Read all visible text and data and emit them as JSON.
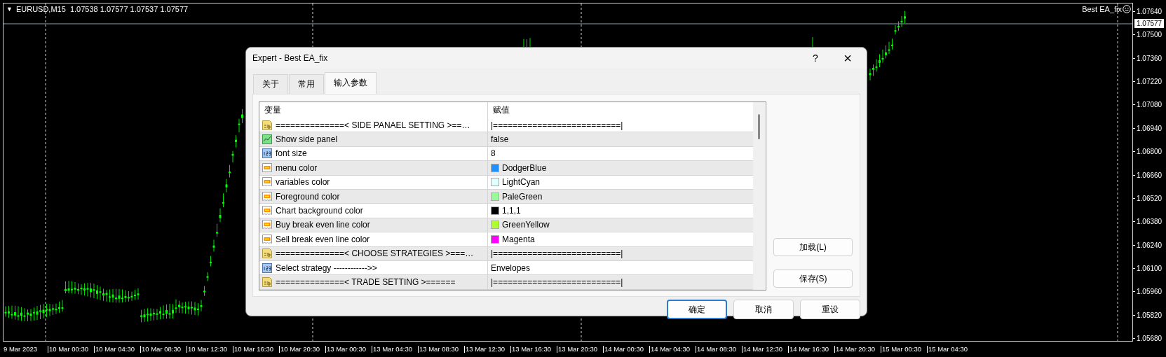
{
  "chart": {
    "symbol_caret": "▼",
    "header": "EURUSD,M15  1.07538 1.07577 1.07537 1.07577",
    "expert_label": "Best EA_fix",
    "current_price": "1.07577",
    "price_axis": [
      "1.07640",
      "1.07500",
      "1.07360",
      "1.07220",
      "1.07080",
      "1.06940",
      "1.06800",
      "1.06660",
      "1.06520",
      "1.06380",
      "1.06240",
      "1.06100",
      "1.05960",
      "1.05820",
      "1.05680"
    ],
    "time_axis": [
      "9 Mar 2023",
      "10 Mar 00:30",
      "10 Mar 04:30",
      "10 Mar 08:30",
      "10 Mar 12:30",
      "10 Mar 16:30",
      "10 Mar 20:30",
      "13 Mar 00:30",
      "13 Mar 04:30",
      "13 Mar 08:30",
      "13 Mar 12:30",
      "13 Mar 16:30",
      "13 Mar 20:30",
      "14 Mar 00:30",
      "14 Mar 04:30",
      "14 Mar 08:30",
      "14 Mar 12:30",
      "14 Mar 16:30",
      "14 Mar 20:30",
      "15 Mar 00:30",
      "15 Mar 04:30"
    ]
  },
  "dialog": {
    "title": "Expert - Best EA_fix",
    "help": "?",
    "close": "×",
    "tabs": [
      {
        "label": "关于",
        "selected": false
      },
      {
        "label": "常用",
        "selected": false
      },
      {
        "label": "输入参数",
        "selected": true
      }
    ],
    "columns": [
      "变量",
      "赋值"
    ],
    "rows": [
      {
        "kind": "string",
        "name": "==============< SIDE PANAEL SETTING >==…",
        "value": "|==========================|"
      },
      {
        "kind": "bool",
        "name": "Show side panel",
        "value": "false"
      },
      {
        "kind": "int",
        "name": "font size",
        "value": "8"
      },
      {
        "kind": "color",
        "name": "menu color",
        "value": "DodgerBlue",
        "color": "#1e90ff"
      },
      {
        "kind": "color",
        "name": "variables color",
        "value": "LightCyan",
        "color": "#e0ffff"
      },
      {
        "kind": "color",
        "name": "Foreground color",
        "value": "PaleGreen",
        "color": "#98fb98"
      },
      {
        "kind": "color",
        "name": "Chart background color",
        "value": "1,1,1",
        "color": "#010101"
      },
      {
        "kind": "color",
        "name": "Buy break even line color",
        "value": "GreenYellow",
        "color": "#adff2f"
      },
      {
        "kind": "color",
        "name": "Sell break even line color",
        "value": "Magenta",
        "color": "#ff00ff"
      },
      {
        "kind": "string",
        "name": "==============< CHOOSE STRATEGIES >===…",
        "value": "|==========================|"
      },
      {
        "kind": "int",
        "name": "Select strategy ------------>>",
        "value": "Envelopes"
      },
      {
        "kind": "string",
        "name": "==============< TRADE SETTING >======",
        "value": "|==========================|"
      }
    ],
    "side_buttons": [
      "加载(L)",
      "保存(S)"
    ],
    "footer_buttons": [
      {
        "label": "确定",
        "selected": true
      },
      {
        "label": "取消",
        "selected": false
      },
      {
        "label": "重设",
        "selected": false
      }
    ]
  }
}
